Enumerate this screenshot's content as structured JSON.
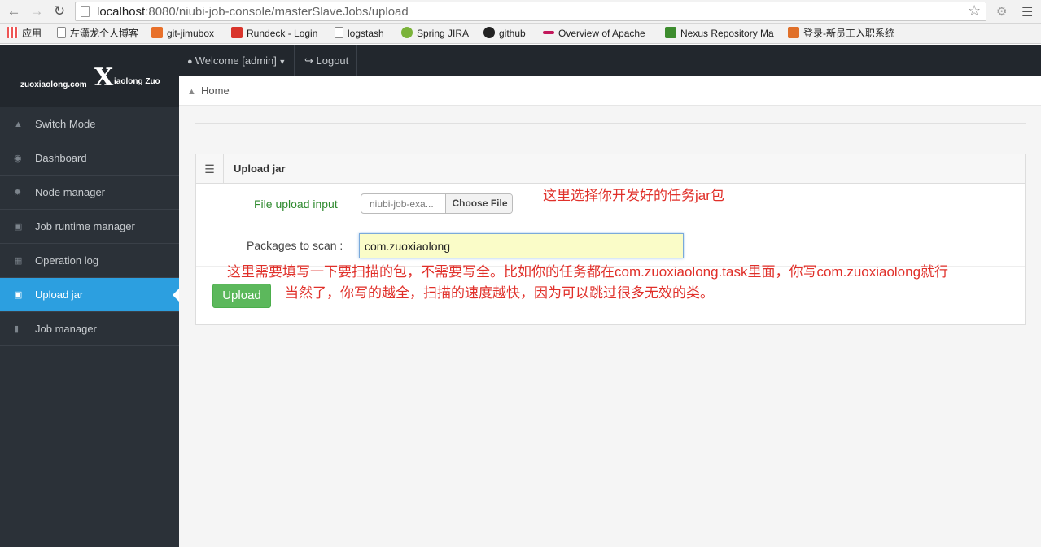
{
  "browser": {
    "url_host": "localhost",
    "url_rest": ":8080/niubi-job-console/masterSlaveJobs/upload",
    "bookmarks": [
      "应用",
      "左潇龙个人博客",
      "git-jimubox",
      "Rundeck - Login",
      "logstash",
      "Spring JIRA",
      "github",
      "Overview of Apache",
      "Nexus Repository Ma",
      "登录-新员工入职系统"
    ]
  },
  "logo": {
    "left": "zuoxiaolong.com",
    "mark": "X",
    "right": "iaolong Zuo"
  },
  "sidebar": {
    "items": [
      {
        "label": "Switch Mode",
        "icon": "home-icon"
      },
      {
        "label": "Dashboard",
        "icon": "dashboard-icon"
      },
      {
        "label": "Node manager",
        "icon": "gear-icon"
      },
      {
        "label": "Job runtime manager",
        "icon": "inbox-icon"
      },
      {
        "label": "Operation log",
        "icon": "grid-icon"
      },
      {
        "label": "Upload jar",
        "icon": "inbox-icon",
        "active": true
      },
      {
        "label": "Job manager",
        "icon": "bar-chart-icon"
      }
    ]
  },
  "topbar": {
    "welcome": "Welcome [admin]",
    "logout": "Logout"
  },
  "breadcrumb": {
    "home": "Home"
  },
  "panel": {
    "title": "Upload jar",
    "file_label": "File upload input",
    "file_name": "niubi-job-exa...",
    "choose_file": "Choose File",
    "pkg_label": "Packages to scan :",
    "pkg_value": "com.zuoxiaolong",
    "upload": "Upload"
  },
  "annotations": {
    "note1": "这里选择你开发好的任务jar包",
    "note2": "这里需要填写一下要扫描的包，不需要写全。比如你的任务都在com.zuoxiaolong.task里面，你写com.zuoxiaolong就行",
    "note3": "当然了，你写的越全，扫描的速度越快，因为可以跳过很多无效的类。"
  },
  "colors": {
    "sidebar_bg": "#2b3138",
    "active": "#2c9fe0",
    "upload_btn": "#5cb85c",
    "note": "#e0302a",
    "label_green": "#2f8a2f"
  }
}
